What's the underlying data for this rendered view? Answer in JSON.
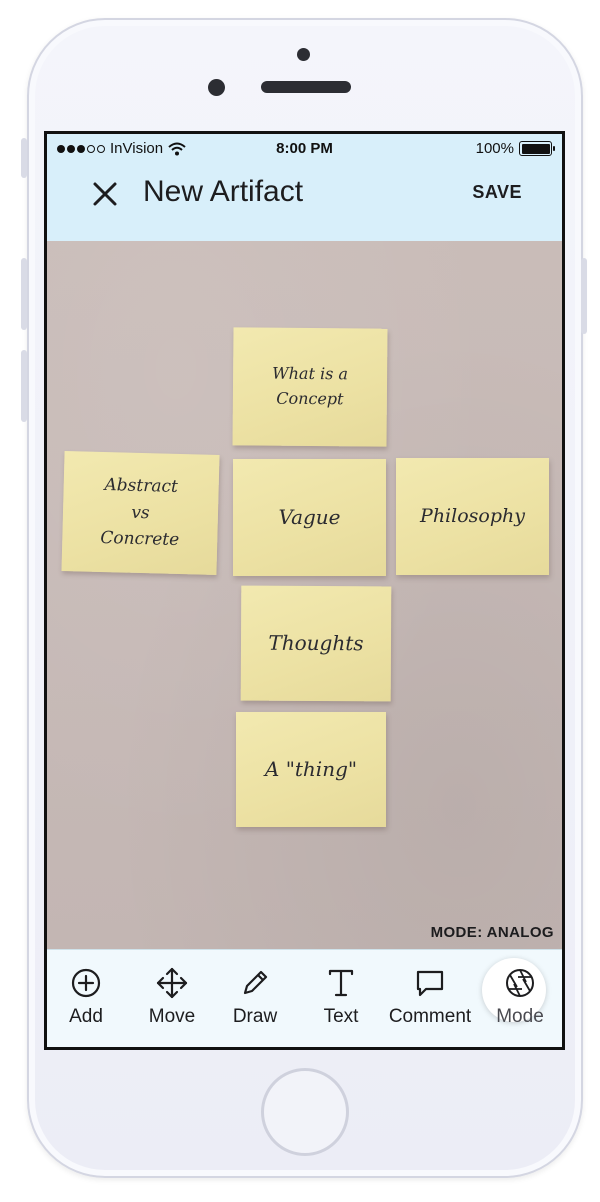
{
  "status_bar": {
    "carrier": "InVision",
    "time": "8:00 PM",
    "battery": "100%",
    "battery_level": 1.0,
    "signal_bars_filled": 3,
    "signal_bars_total": 5
  },
  "header": {
    "title": "New Artifact",
    "save_label": "SAVE",
    "background": "#d8effa"
  },
  "canvas": {
    "mode_label": "MODE: ANALOG",
    "notes": [
      {
        "text": "What is a\nConcept"
      },
      {
        "text": "Abstract\nvs\nConcrete"
      },
      {
        "text": "Vague"
      },
      {
        "text": "Philosophy"
      },
      {
        "text": "Thoughts"
      },
      {
        "text": "A \"thing\""
      }
    ]
  },
  "toolbar": {
    "items": [
      {
        "label": "Add",
        "icon": "plus-circle-icon"
      },
      {
        "label": "Move",
        "icon": "move-arrows-icon"
      },
      {
        "label": "Draw",
        "icon": "pencil-icon"
      },
      {
        "label": "Text",
        "icon": "text-t-icon"
      },
      {
        "label": "Comment",
        "icon": "speech-bubble-icon"
      },
      {
        "label": "Mode",
        "icon": "aperture-icon",
        "active": true
      }
    ]
  }
}
